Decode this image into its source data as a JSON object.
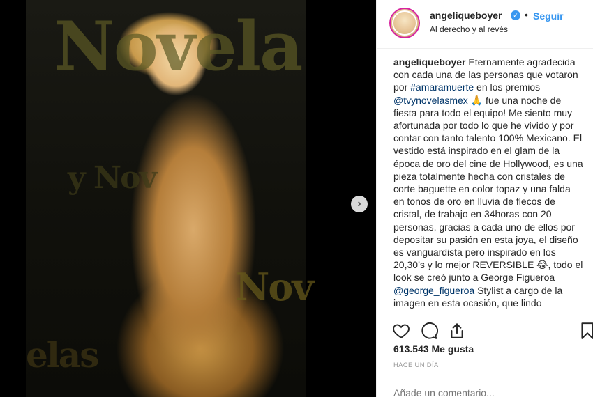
{
  "post": {
    "username": "angeliqueboyer",
    "follow_label": "Seguir",
    "dot": "•",
    "location": "Al derecho y al revés",
    "verified_mark": "✓"
  },
  "media": {
    "background_text": [
      "Novela",
      "y Nov",
      "Nov",
      "elas"
    ],
    "next_icon": "›"
  },
  "caption": {
    "user": "angeliqueboyer",
    "segments": [
      {
        "type": "text",
        "value": " Eternamente agradecida con cada una de las personas que votaron por "
      },
      {
        "type": "link",
        "value": "#amaramuerte"
      },
      {
        "type": "text",
        "value": " en los premios "
      },
      {
        "type": "link",
        "value": "@tvynovelasmex"
      },
      {
        "type": "text",
        "value": " 🙏 fue una noche de fiesta para todo el equipo! Me siento muy afortunada por todo lo que he vivido y por contar con tanto talento 100% Mexicano. El vestido está inspirado en el glam de la época de oro del cine de Hollywood, es una pieza totalmente hecha con cristales de corte baguette en color topaz y una falda en tonos de oro en lluvia de flecos de cristal, de trabajo en 34horas con 20 personas, gracias a cada uno de ellos por depositar su pasión en esta joya, el diseño es vanguardista pero inspirado en los 20,30’s y lo mejor REVERSIBLE 😂, todo el look se creó junto a George Figueroa "
      },
      {
        "type": "link",
        "value": "@george_figueroa"
      },
      {
        "type": "text",
        "value": " Stylist a cargo de la imagen en esta ocasión, que lindo"
      }
    ]
  },
  "engagement": {
    "likes_count": "613.543",
    "likes_label": "Me gusta",
    "timestamp": "Hace un día"
  },
  "comment": {
    "placeholder": "Añade un comentario..."
  },
  "icons": {
    "like": "heart-icon",
    "comment": "comment-icon",
    "share": "share-icon",
    "save": "bookmark-icon",
    "verified": "verified-badge-icon",
    "next": "chevron-right-icon"
  },
  "colors": {
    "accent": "#3897f0",
    "link": "#003569",
    "muted": "#999999"
  }
}
